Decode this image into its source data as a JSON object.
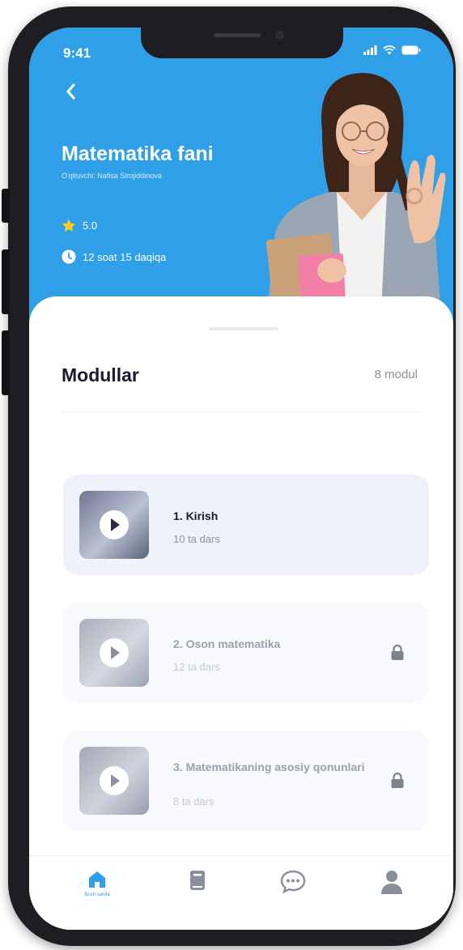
{
  "status_bar": {
    "time": "9:41"
  },
  "course": {
    "title": "Matematika fani",
    "teacher": "O'qituvchi: Nafisa Sirojiddinova",
    "rating": "5.0",
    "duration": "12 soat 15 daqiqa"
  },
  "modules_section": {
    "title": "Modullar",
    "count": "8 modul"
  },
  "modules": [
    {
      "title": "1. Kirish",
      "lessons": "10 ta dars",
      "locked": false
    },
    {
      "title": "2. Oson matematika",
      "lessons": "12 ta dars",
      "locked": true
    },
    {
      "title": "3. Matematikaning asosiy qonunlari",
      "lessons": "8 ta dars",
      "locked": true
    }
  ],
  "tab_bar": {
    "home_label": "Bosh sahifa"
  },
  "colors": {
    "primary": "#2f9fe8",
    "star": "#ffcc1f",
    "active_card": "#eef3fb",
    "locked_card": "#f7f9fc",
    "tab_inactive": "#8a8f9c"
  },
  "icons": [
    "back-icon",
    "star-icon",
    "clock-icon",
    "play-icon",
    "lock-icon",
    "home-icon",
    "book-icon",
    "chat-icon",
    "profile-icon",
    "signal-icon",
    "wifi-icon",
    "battery-icon"
  ]
}
